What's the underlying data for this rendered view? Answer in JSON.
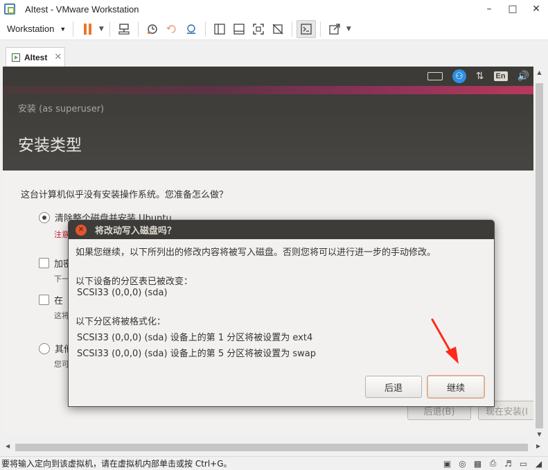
{
  "window": {
    "title": "AItest - VMware Workstation"
  },
  "toolbar": {
    "workstation_label": "Workstation"
  },
  "tabs": [
    {
      "label": "AItest"
    }
  ],
  "ubuntu_panel": {
    "lang_label": "En"
  },
  "installer": {
    "superuser_text": "安装 (as superuser)",
    "title": "安装类型",
    "question": "这台计算机似乎没有安装操作系统。您准备怎么做？",
    "options": [
      {
        "label": "清除整个磁盘并安装 Ubuntu",
        "sub": "注意",
        "type": "radio",
        "checked": true
      },
      {
        "label": "加密",
        "sub": "下一",
        "type": "checkbox",
        "checked": false
      },
      {
        "label": "在",
        "sub": "这将",
        "type": "checkbox",
        "checked": false
      },
      {
        "label": "其他",
        "sub": "您可",
        "type": "radio",
        "checked": false
      }
    ],
    "back_button": "后退(B)",
    "install_button": "现在安装(I"
  },
  "dialog": {
    "title": "将改动写入磁盘吗？",
    "intro": "如果您继续，以下所列出的修改内容将被写入磁盘。否则您将可以进行进一步的手动修改。",
    "partition_table_heading": "以下设备的分区表已被改变：",
    "partition_table_device": "SCSI33 (0,0,0) (sda)",
    "format_heading": "以下分区将被格式化：",
    "format_items": [
      "SCSI33 (0,0,0) (sda) 设备上的第 1 分区将被设置为 ext4",
      "SCSI33 (0,0,0) (sda) 设备上的第 5 分区将被设置为 swap"
    ],
    "back_button": "后退",
    "continue_button": "继续"
  },
  "statusbar": {
    "text": "要将输入定向到该虚拟机，请在虚拟机内部单击或按 Ctrl+G。"
  },
  "colors": {
    "accent": "#e95420",
    "arrow": "#ff2a1a",
    "panel": "#3c3b37"
  },
  "icons": [
    "vmware-logo-icon",
    "pause-icon",
    "snapshot-icon",
    "fullscreen-icon",
    "console-icon",
    "accessibility-icon",
    "network-icon",
    "volume-icon"
  ]
}
